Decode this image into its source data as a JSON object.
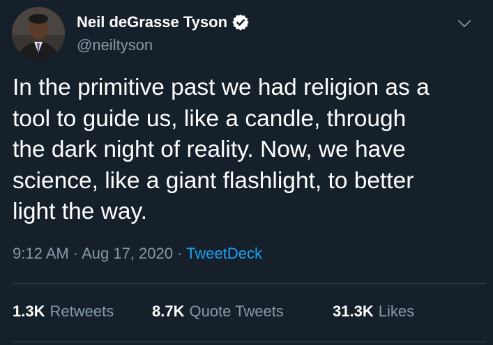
{
  "user": {
    "display_name": "Neil deGrasse Tyson",
    "handle": "@neiltyson",
    "verified_icon": "verified-badge-icon",
    "avatar": "profile-photo"
  },
  "tweet": {
    "lines": [
      "In the primitive past we had religion as a",
      "tool to guide us, like a candle, through",
      "the dark night of reality. Now, we have",
      "science, like a giant flashlight, to better",
      "light the way."
    ],
    "time": "9:12 AM",
    "date": "Aug 17, 2020",
    "separator": "·",
    "source": "TweetDeck"
  },
  "stats": {
    "retweets_count": "1.3K",
    "retweets_label": "Retweets",
    "quotes_count": "8.7K",
    "quotes_label": "Quote Tweets",
    "likes_count": "31.3K",
    "likes_label": "Likes"
  },
  "colors": {
    "background": "#15202b",
    "primary_text": "#ffffff",
    "secondary_text": "#8899a6",
    "link": "#1da1f2",
    "divider": "#38444d"
  },
  "icons": {
    "menu": "chevron-down-icon"
  }
}
